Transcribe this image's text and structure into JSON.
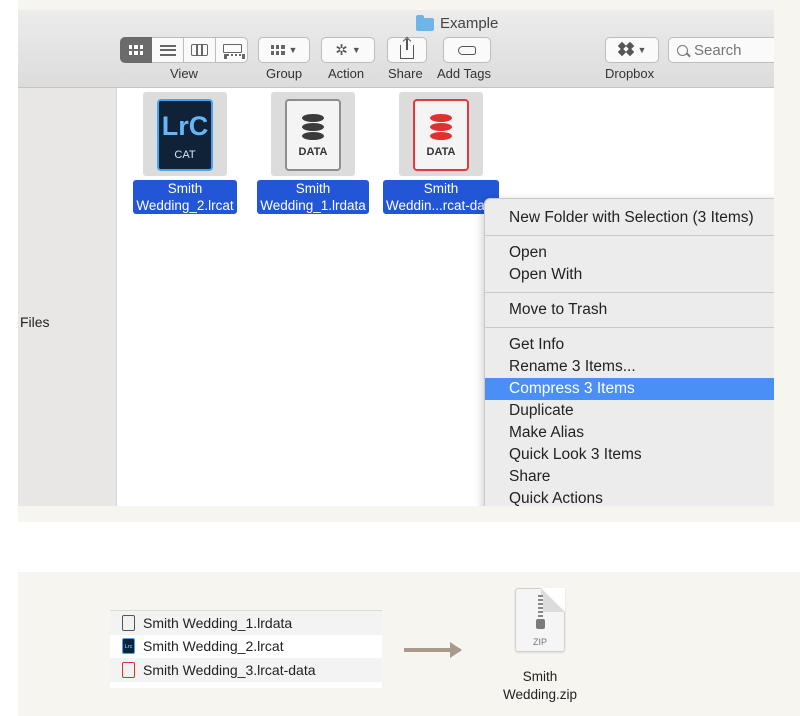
{
  "window": {
    "title": "Example"
  },
  "toolbar": {
    "view_label": "View",
    "group_label": "Group",
    "action_label": "Action",
    "share_label": "Share",
    "add_tags_label": "Add Tags",
    "dropbox_label": "Dropbox",
    "search_placeholder": "Search"
  },
  "sidebar": {
    "files_label": "Files"
  },
  "files": [
    {
      "name_line1": "Smith",
      "name_line2": "Wedding_2.lrcat",
      "icon": "lightroom-catalog-icon",
      "icon_text": "LrC",
      "icon_sub": "CAT"
    },
    {
      "name_line1": "Smith",
      "name_line2": "Wedding_1.lrdata",
      "icon": "data-file-icon",
      "icon_sub": "DATA"
    },
    {
      "name_line1": "Smith",
      "name_line2": "Weddin...rcat-data",
      "icon": "data-file-red-icon",
      "icon_sub": "DATA"
    }
  ],
  "context_menu": {
    "items": [
      "New Folder with Selection (3 Items)",
      "Open",
      "Open With",
      "Move to Trash",
      "Get Info",
      "Rename 3 Items...",
      "Compress 3 Items",
      "Duplicate",
      "Make Alias",
      "Quick Look 3 Items",
      "Share",
      "Quick Actions"
    ],
    "highlighted": "Compress 3 Items",
    "highlight_color": "#4a8ff5"
  },
  "illustration": {
    "list": [
      "Smith Wedding_1.lrdata",
      "Smith Wedding_2.lrcat",
      "Smith Wedding_3.lrcat-data"
    ],
    "zip_icon_label": "ZIP",
    "zip_name_line1": "Smith",
    "zip_name_line2": "Wedding.zip"
  },
  "colors": {
    "selection": "#2356d6",
    "accent_blue": "#46a5ee",
    "data_red": "#e03a3a",
    "arrow": "#a79b8c"
  }
}
